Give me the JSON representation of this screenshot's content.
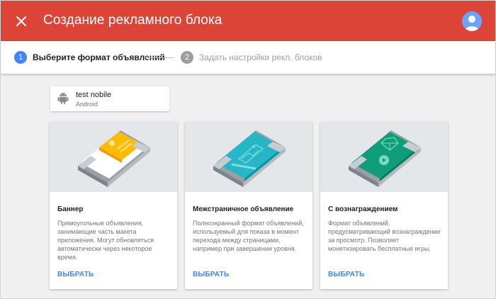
{
  "header": {
    "title": "Создание рекламного блока"
  },
  "stepper": {
    "steps": [
      {
        "number": "1",
        "label": "Выберите формат объявлений",
        "active": true
      },
      {
        "number": "2",
        "label": "Задать настройки рекл. блоков",
        "active": false
      }
    ]
  },
  "app": {
    "name": "test nobile",
    "platform": "Android"
  },
  "cards": [
    {
      "title": "Баннер",
      "description": "Прямоугольные объявления, занимающие часть макета приложения. Могут обновляться автоматически через некоторое время.",
      "action": "ВЫБРАТЬ"
    },
    {
      "title": "Межстраничное объявление",
      "description": "Полноэкранный формат объявлений, используемый для показа в момент перехода между страницами, например при завершении уровня.",
      "action": "ВЫБРАТЬ"
    },
    {
      "title": "С вознаграждением",
      "description": "Формат объявлений, предусматривающий вознаграждение за просмотр. Позволяет монетизировать бесплатные игры.",
      "action": "ВЫБРАТЬ"
    }
  ],
  "colors": {
    "header": "#db4437",
    "step_active": "#4285f4",
    "step_inactive": "#9e9e9e",
    "action": "#4285f4",
    "banner_yellow": "#fbbc04",
    "interstitial_teal": "#26b6c6",
    "rewarded_green": "#0f9d7a"
  }
}
